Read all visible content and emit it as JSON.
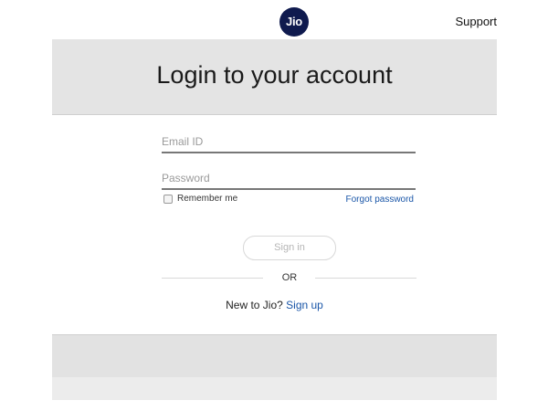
{
  "header": {
    "logo_text": "Jio",
    "support_label": "Support"
  },
  "banner": {
    "title": "Login to your account"
  },
  "form": {
    "email_placeholder": "Email ID",
    "email_value": "",
    "password_placeholder": "Password",
    "password_value": "",
    "remember_label": "Remember me",
    "remember_checked": false,
    "forgot_label": "Forgot password",
    "signin_label": "Sign in",
    "divider_label": "OR",
    "signup_prompt": "New to Jio?",
    "signup_label": "Sign up"
  },
  "colors": {
    "brand_navy": "#0f1a4e",
    "link_blue": "#1a56a8",
    "banner_gray": "#e4e4e4"
  }
}
